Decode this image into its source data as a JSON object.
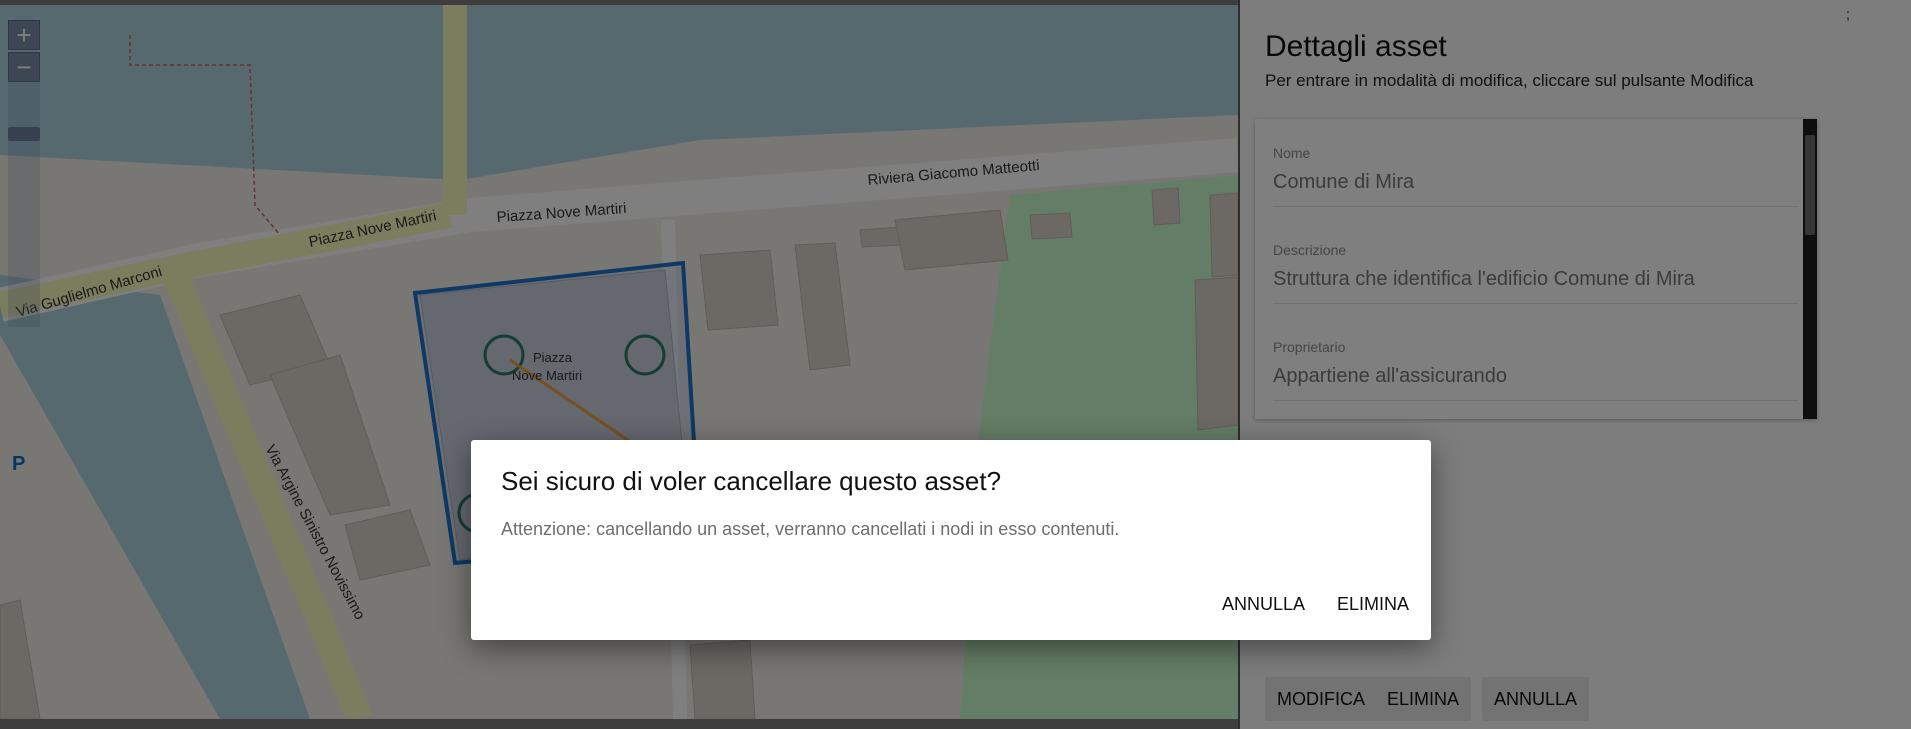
{
  "map": {
    "zoom_in_label": "+",
    "zoom_out_label": "−",
    "streets": [
      "Piazza Nove Martiri",
      "Piazza Nove Martiri",
      "Riviera Giacomo Matteotti",
      "Via Guglielmo Marconi",
      "Via Argine Sinistro Novissimo"
    ],
    "poi_line1": "Piazza",
    "poi_line2": "Nove Martiri",
    "parking_label": "P",
    "colors": {
      "water": "#aad3df",
      "road": "#f7fabf",
      "park": "#c8facc",
      "building": "#d9d0c9",
      "selection": "#1a73c8",
      "line": "#e8a33d"
    }
  },
  "panel": {
    "title": "Dettagli asset",
    "subtitle": "Per entrare in modalità di modifica, cliccare sul pulsante Modifica",
    "stray_char": ";",
    "fields": [
      {
        "label": "Nome",
        "value": "Comune di Mira"
      },
      {
        "label": "Descrizione",
        "value": "Struttura che identifica l'edificio Comune di Mira"
      },
      {
        "label": "Proprietario",
        "value": "Appartiene all'assicurando"
      }
    ],
    "buttons": {
      "edit": "MODIFICA",
      "delete": "ELIMINA",
      "cancel": "ANNULLA"
    }
  },
  "dialog": {
    "title": "Sei sicuro di voler cancellare questo asset?",
    "message": "Attenzione: cancellando un asset, verranno cancellati i nodi in esso contenuti.",
    "cancel_label": "ANNULLA",
    "confirm_label": "ELIMINA"
  }
}
